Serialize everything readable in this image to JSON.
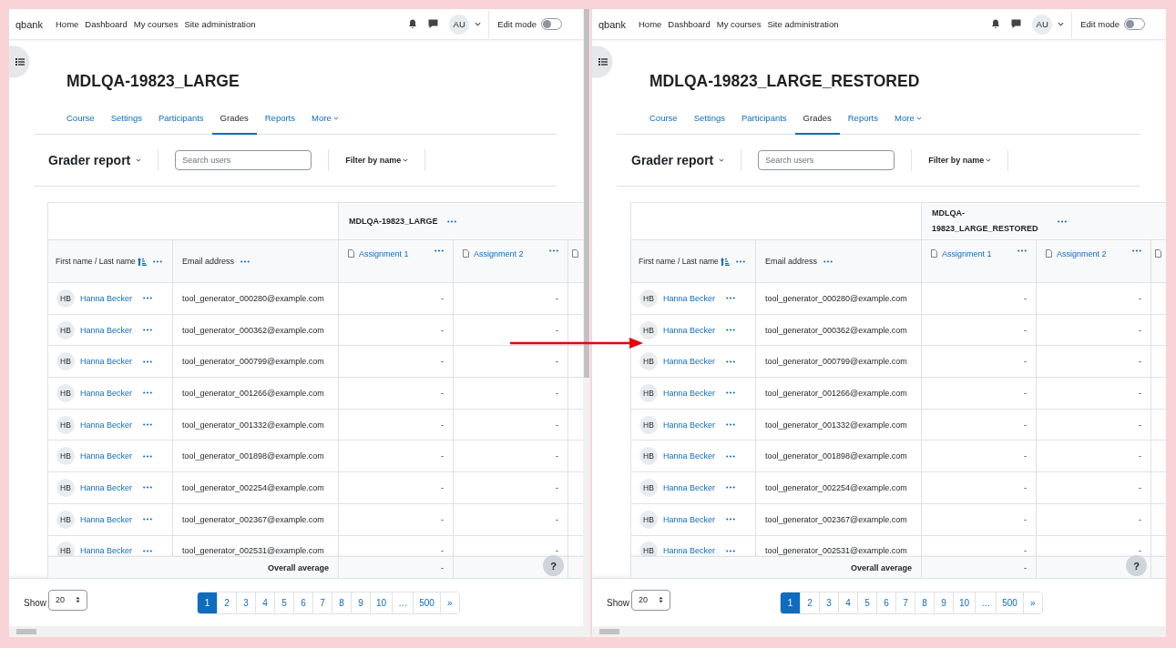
{
  "panes": [
    {
      "site_name": "qbank",
      "nav": [
        {
          "label": "Home"
        },
        {
          "label": "Dashboard"
        },
        {
          "label": "My courses"
        },
        {
          "label": "Site administration"
        }
      ],
      "avatar": "AU",
      "edit_mode": {
        "label": "Edit mode",
        "on": false
      },
      "course_title": "MDLQA-19823_LARGE",
      "tabs": [
        {
          "label": "Course",
          "selected": false
        },
        {
          "label": "Settings",
          "selected": false
        },
        {
          "label": "Participants",
          "selected": false
        },
        {
          "label": "Grades",
          "selected": true
        },
        {
          "label": "Reports",
          "selected": false
        },
        {
          "label": "More",
          "selected": false
        }
      ],
      "report_title": "Grader report",
      "search": {
        "placeholder": "Search users"
      },
      "filter": "Filter by name",
      "table": {
        "category": "MDLQA-19823_LARGE",
        "columns": [
          {
            "label": "First name / Last name",
            "kind": "name"
          },
          {
            "label": "Email address",
            "kind": "email"
          },
          {
            "label": "Assignment 1",
            "kind": "assignment"
          },
          {
            "label": "Assignment 2",
            "kind": "assignment"
          },
          {
            "kind": "cut"
          }
        ],
        "rows": [
          {
            "initials": "HB",
            "name": "Hanna Becker",
            "email": "tool_generator_000280@example.com",
            "grades": [
              "-",
              "-"
            ]
          },
          {
            "initials": "HB",
            "name": "Hanna Becker",
            "email": "tool_generator_000362@example.com",
            "grades": [
              "-",
              "-"
            ]
          },
          {
            "initials": "HB",
            "name": "Hanna Becker",
            "email": "tool_generator_000799@example.com",
            "grades": [
              "-",
              "-"
            ]
          },
          {
            "initials": "HB",
            "name": "Hanna Becker",
            "email": "tool_generator_001266@example.com",
            "grades": [
              "-",
              "-"
            ]
          },
          {
            "initials": "HB",
            "name": "Hanna Becker",
            "email": "tool_generator_001332@example.com",
            "grades": [
              "-",
              "-"
            ]
          },
          {
            "initials": "HB",
            "name": "Hanna Becker",
            "email": "tool_generator_001898@example.com",
            "grades": [
              "-",
              "-"
            ]
          },
          {
            "initials": "HB",
            "name": "Hanna Becker",
            "email": "tool_generator_002254@example.com",
            "grades": [
              "-",
              "-"
            ]
          },
          {
            "initials": "HB",
            "name": "Hanna Becker",
            "email": "tool_generator_002367@example.com",
            "grades": [
              "-",
              "-"
            ]
          },
          {
            "initials": "HB",
            "name": "Hanna Becker",
            "email": "tool_generator_002531@example.com",
            "grades": [
              "-",
              "-"
            ]
          }
        ],
        "average": {
          "label": "Overall average",
          "grades": [
            "-"
          ]
        }
      },
      "show": {
        "label": "Show",
        "value": "20"
      },
      "pages": [
        {
          "label": "1",
          "selected": true
        },
        {
          "label": "2",
          "selected": false
        },
        {
          "label": "3",
          "selected": false
        },
        {
          "label": "4",
          "selected": false
        },
        {
          "label": "5",
          "selected": false
        },
        {
          "label": "6",
          "selected": false
        },
        {
          "label": "7",
          "selected": false
        },
        {
          "label": "8",
          "selected": false
        },
        {
          "label": "9",
          "selected": false
        },
        {
          "label": "10",
          "selected": false
        },
        {
          "label": "…",
          "selected": false
        },
        {
          "label": "500",
          "selected": false
        },
        {
          "label": "»",
          "selected": false
        }
      ],
      "help": "?"
    },
    {
      "site_name": "qbank",
      "nav": [
        {
          "label": "Home"
        },
        {
          "label": "Dashboard"
        },
        {
          "label": "My courses"
        },
        {
          "label": "Site administration"
        }
      ],
      "avatar": "AU",
      "edit_mode": {
        "label": "Edit mode",
        "on": false
      },
      "course_title": "MDLQA-19823_LARGE_RESTORED",
      "tabs": [
        {
          "label": "Course",
          "selected": false
        },
        {
          "label": "Settings",
          "selected": false
        },
        {
          "label": "Participants",
          "selected": false
        },
        {
          "label": "Grades",
          "selected": true
        },
        {
          "label": "Reports",
          "selected": false
        },
        {
          "label": "More",
          "selected": false
        }
      ],
      "report_title": "Grader report",
      "search": {
        "placeholder": "Search users"
      },
      "filter": "Filter by name",
      "table": {
        "category": "MDLQA-19823_LARGE_RESTORED",
        "columns": [
          {
            "label": "First name / Last name",
            "kind": "name"
          },
          {
            "label": "Email address",
            "kind": "email"
          },
          {
            "label": "Assignment 1",
            "kind": "assignment"
          },
          {
            "label": "Assignment 2",
            "kind": "assignment"
          },
          {
            "kind": "cut"
          }
        ],
        "rows": [
          {
            "initials": "HB",
            "name": "Hanna Becker",
            "email": "tool_generator_000280@example.com",
            "grades": [
              "-",
              "-"
            ]
          },
          {
            "initials": "HB",
            "name": "Hanna Becker",
            "email": "tool_generator_000362@example.com",
            "grades": [
              "-",
              "-"
            ]
          },
          {
            "initials": "HB",
            "name": "Hanna Becker",
            "email": "tool_generator_000799@example.com",
            "grades": [
              "-",
              "-"
            ]
          },
          {
            "initials": "HB",
            "name": "Hanna Becker",
            "email": "tool_generator_001266@example.com",
            "grades": [
              "-",
              "-"
            ]
          },
          {
            "initials": "HB",
            "name": "Hanna Becker",
            "email": "tool_generator_001332@example.com",
            "grades": [
              "-",
              "-"
            ]
          },
          {
            "initials": "HB",
            "name": "Hanna Becker",
            "email": "tool_generator_001898@example.com",
            "grades": [
              "-",
              "-"
            ]
          },
          {
            "initials": "HB",
            "name": "Hanna Becker",
            "email": "tool_generator_002254@example.com",
            "grades": [
              "-",
              "-"
            ]
          },
          {
            "initials": "HB",
            "name": "Hanna Becker",
            "email": "tool_generator_002367@example.com",
            "grades": [
              "-",
              "-"
            ]
          },
          {
            "initials": "HB",
            "name": "Hanna Becker",
            "email": "tool_generator_002531@example.com",
            "grades": [
              "-",
              "-"
            ]
          }
        ],
        "average": {
          "label": "Overall average",
          "grades": [
            "-"
          ]
        }
      },
      "show": {
        "label": "Show",
        "value": "20"
      },
      "pages": [
        {
          "label": "1",
          "selected": true
        },
        {
          "label": "2",
          "selected": false
        },
        {
          "label": "3",
          "selected": false
        },
        {
          "label": "4",
          "selected": false
        },
        {
          "label": "5",
          "selected": false
        },
        {
          "label": "6",
          "selected": false
        },
        {
          "label": "7",
          "selected": false
        },
        {
          "label": "8",
          "selected": false
        },
        {
          "label": "9",
          "selected": false
        },
        {
          "label": "10",
          "selected": false
        },
        {
          "label": "…",
          "selected": false
        },
        {
          "label": "500",
          "selected": false
        },
        {
          "label": "»",
          "selected": false
        }
      ],
      "help": "?"
    }
  ]
}
